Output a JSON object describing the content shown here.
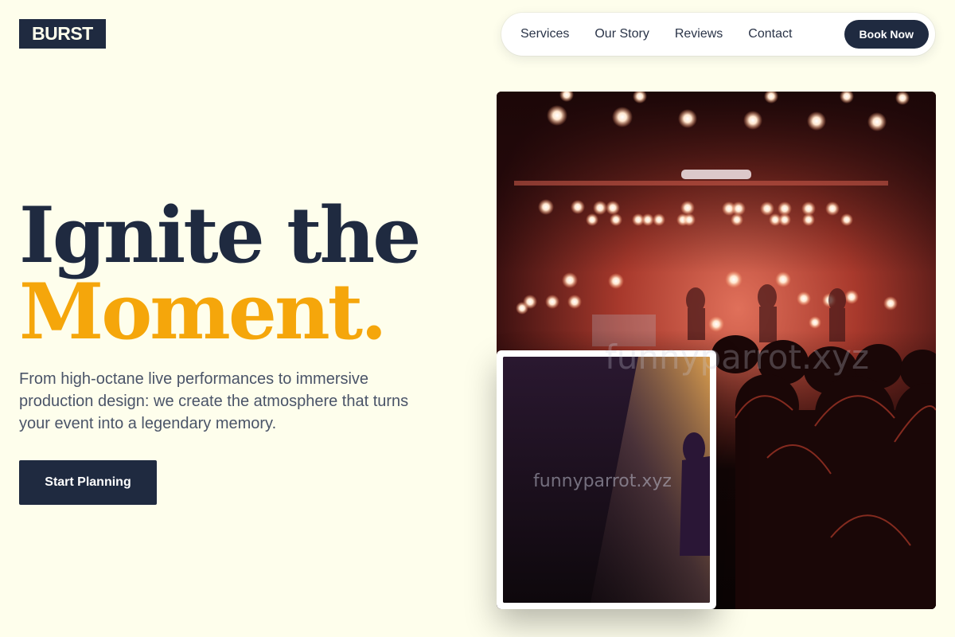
{
  "brand": {
    "logo": "BURST"
  },
  "nav": {
    "links": [
      "Services",
      "Our Story",
      "Reviews",
      "Contact"
    ],
    "cta": "Book Now"
  },
  "hero": {
    "headline_line1": "Ignite the",
    "headline_line2": "Moment.",
    "subtext": "From high-octane live performances to immersive production design: we create the atmosphere that turns your event into a legendary memory.",
    "cta": "Start Planning"
  },
  "images": {
    "main": "concert-crowd-photo",
    "inset": "spotlight-performer-photo",
    "watermark": "funnyparrot.xyz"
  },
  "colors": {
    "background": "#fefeec",
    "navy": "#1f2a40",
    "accent": "#f5a60b"
  }
}
